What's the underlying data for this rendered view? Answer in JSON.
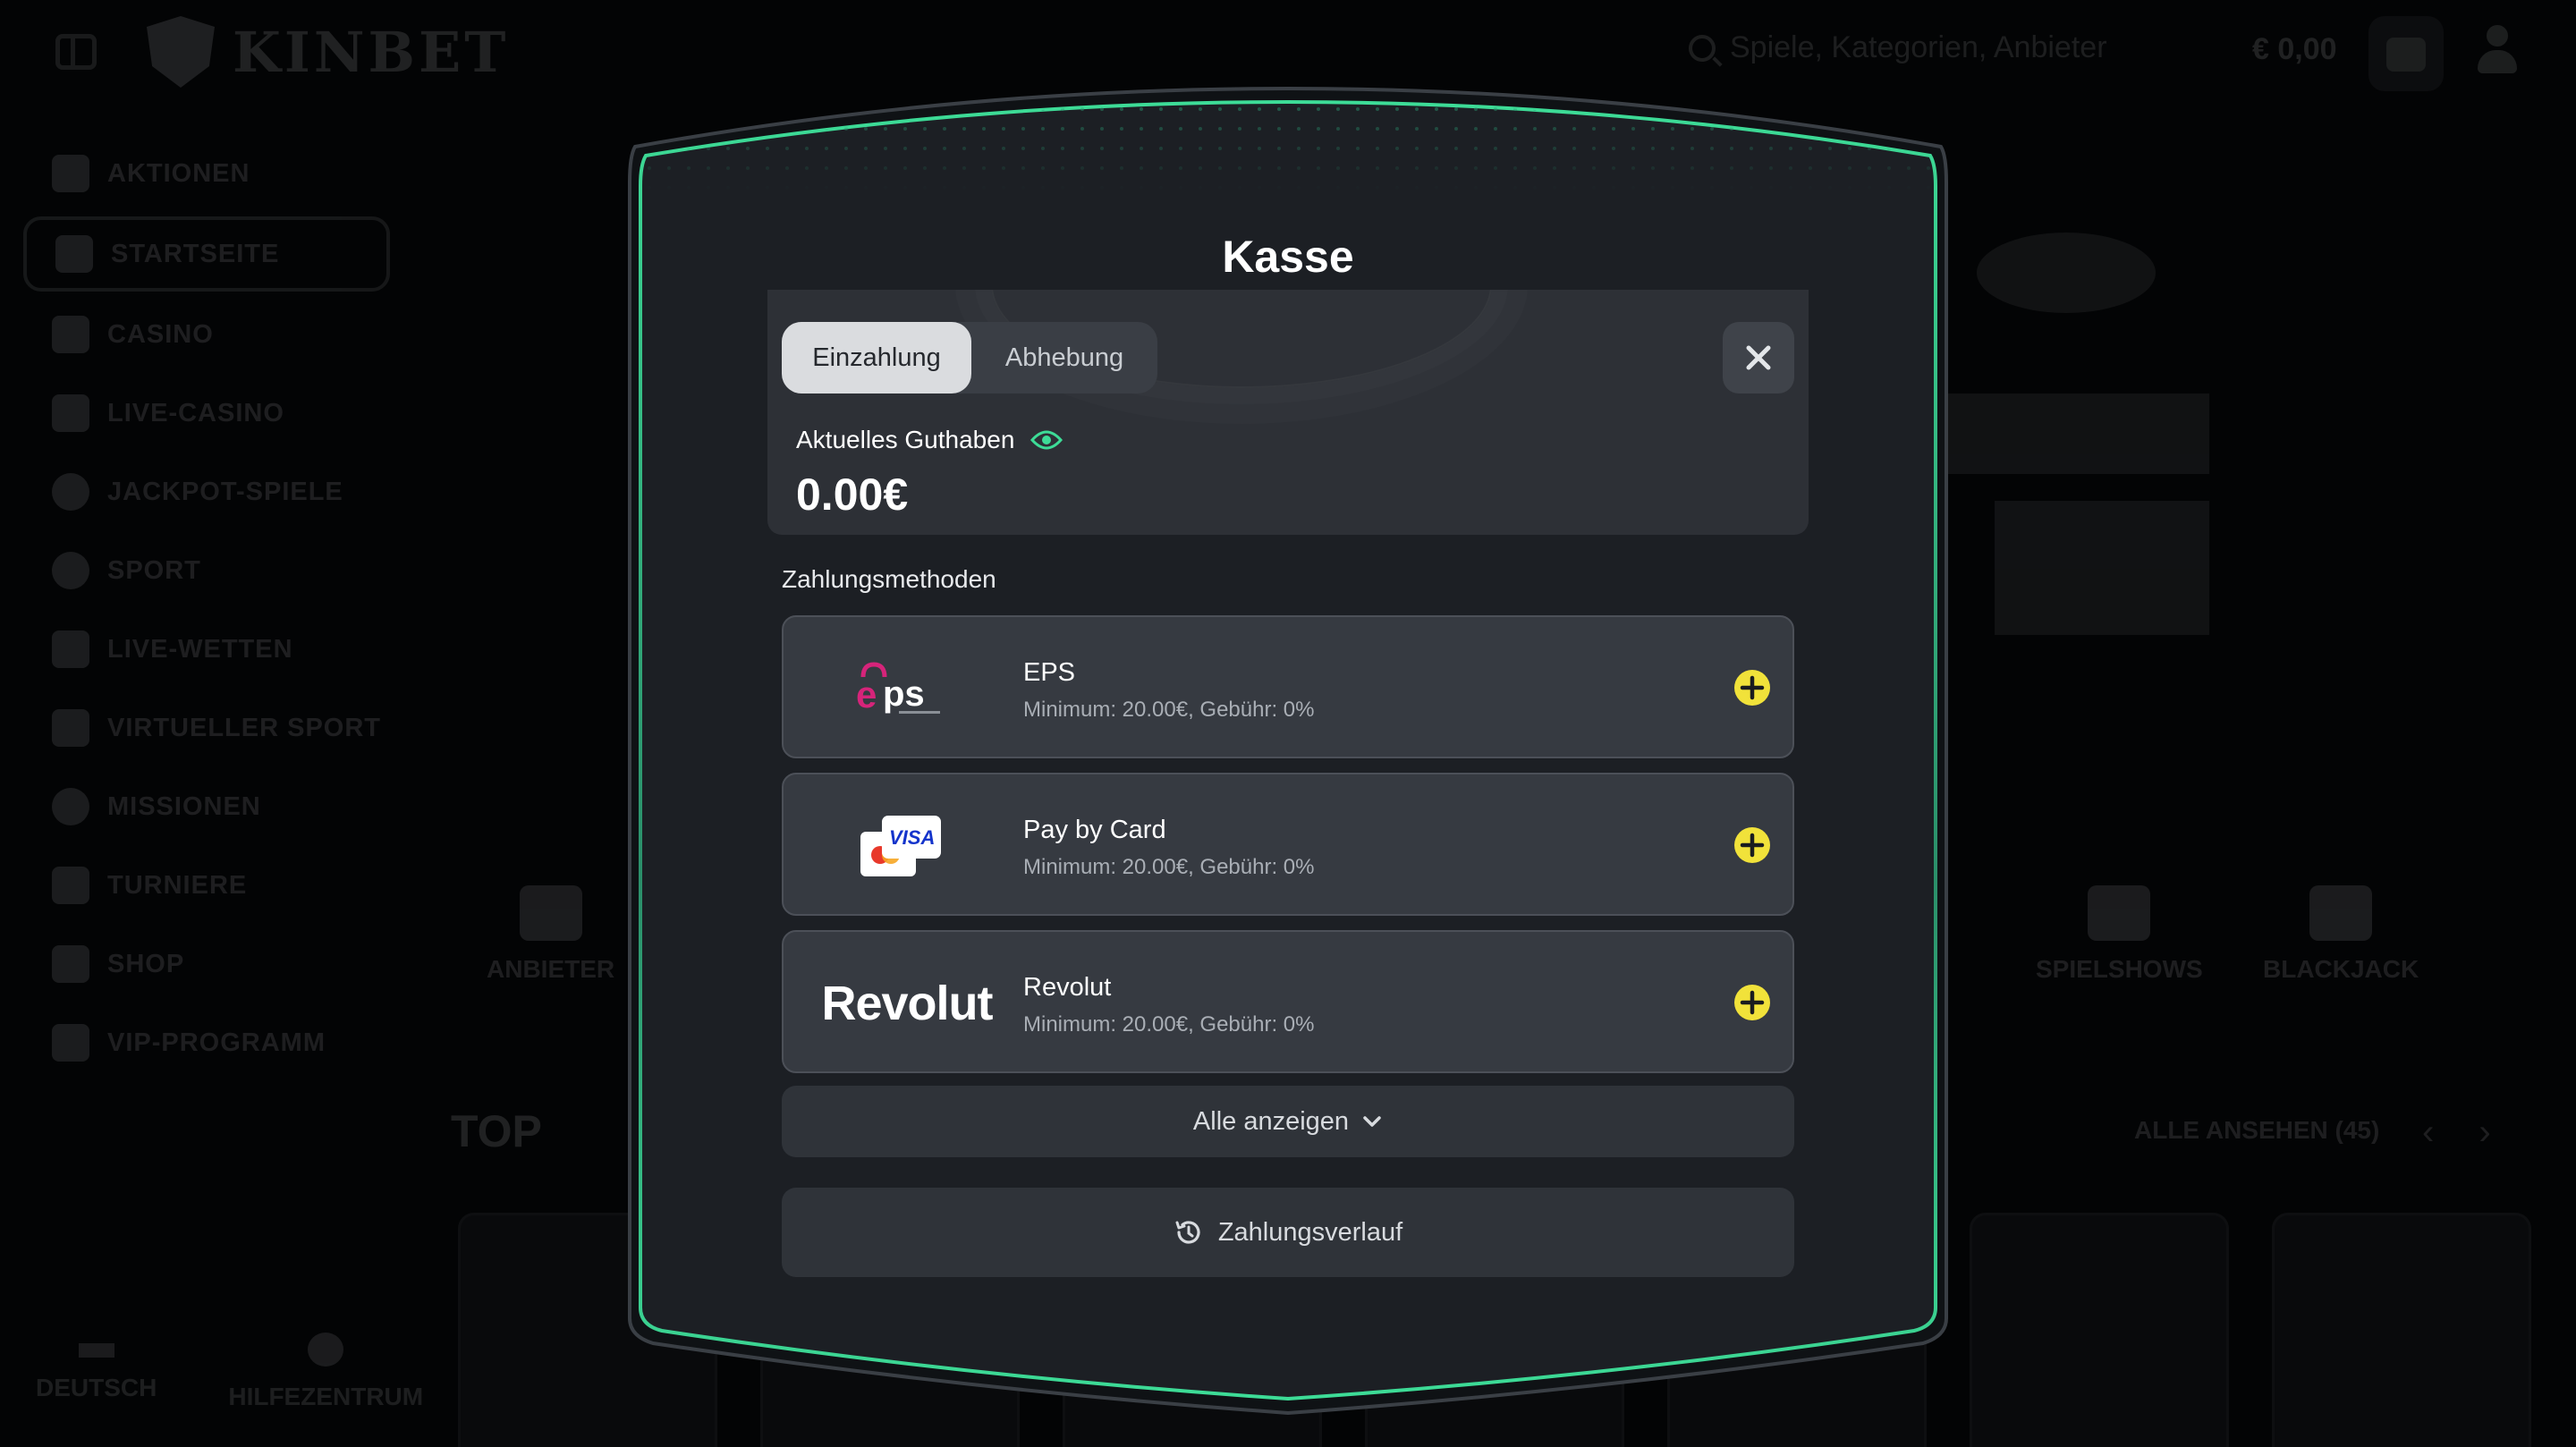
{
  "header": {
    "brand": "KINBET",
    "search_placeholder": "Spiele, Kategorien, Anbieter",
    "balance": "€ 0,00"
  },
  "sidebar": {
    "items": [
      {
        "label": "AKTIONEN",
        "icon": "gift-icon"
      },
      {
        "label": "STARTSEITE",
        "icon": "home-icon",
        "active": true
      },
      {
        "label": "CASINO",
        "icon": "slot-machine-icon"
      },
      {
        "label": "LIVE-CASINO",
        "icon": "cards-icon"
      },
      {
        "label": "JACKPOT-SPIELE",
        "icon": "clover-icon"
      },
      {
        "label": "SPORT",
        "icon": "soccer-ball-icon"
      },
      {
        "label": "LIVE-WETTEN",
        "icon": "live-icon"
      },
      {
        "label": "VIRTUELLER SPORT",
        "icon": "monitor-icon"
      },
      {
        "label": "MISSIONEN",
        "icon": "target-icon"
      },
      {
        "label": "TURNIERE",
        "icon": "trophy-icon"
      },
      {
        "label": "SHOP",
        "icon": "basket-icon"
      },
      {
        "label": "VIP-PROGRAMM",
        "icon": "diamond-icon"
      }
    ],
    "language": "DEUTSCH",
    "help": "HILFEZENTRUM"
  },
  "categories": [
    "ANBIETER",
    "SPIELSHOWS",
    "BLACKJACK"
  ],
  "top_section": {
    "title": "TOP",
    "see_all": "ALLE ANSEHEN (45)"
  },
  "modal": {
    "title": "Kasse",
    "tabs": [
      {
        "label": "Einzahlung",
        "active": true
      },
      {
        "label": "Abhebung",
        "active": false
      }
    ],
    "balance_label": "Aktuelles Guthaben",
    "balance_value": "0.00€",
    "methods_title": "Zahlungsmethoden",
    "methods": [
      {
        "name": "EPS",
        "info": "Minimum: 20.00€, Gebühr: 0%",
        "logo": "eps-logo"
      },
      {
        "name": "Pay by Card",
        "info": "Minimum: 20.00€, Gebühr: 0%",
        "logo": "card-logo"
      },
      {
        "name": "Revolut",
        "info": "Minimum: 20.00€, Gebühr: 0%",
        "logo": "revolut-logo",
        "logo_text": "Revolut"
      }
    ],
    "show_all": "Alle anzeigen",
    "history": "Zahlungsverlauf",
    "colors": {
      "accent": "#3ddc97",
      "plus": "#f1e23a",
      "eps_pink": "#d6247a"
    }
  }
}
